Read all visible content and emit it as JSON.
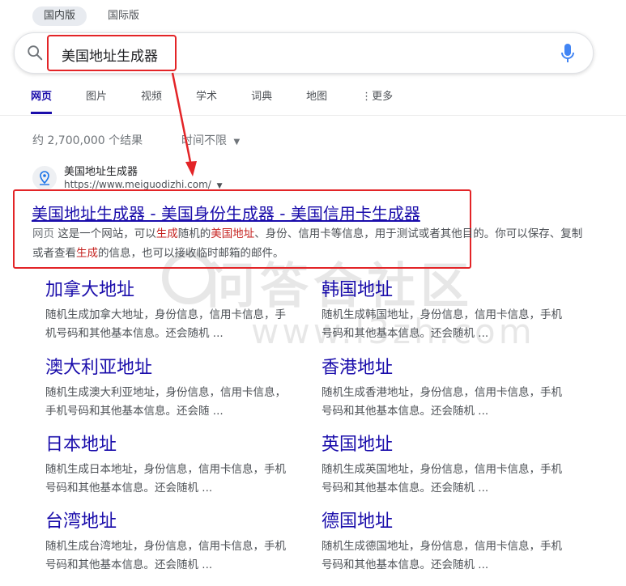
{
  "market_tabs": {
    "domestic": "国内版",
    "international": "国际版"
  },
  "search": {
    "query": "美国地址生成器"
  },
  "nav": {
    "web": "网页",
    "images": "图片",
    "videos": "视频",
    "academic": "学术",
    "dictionary": "词典",
    "maps": "地图",
    "more": "更多"
  },
  "stats": {
    "count": "约 2,700,000 个结果",
    "time_filter": "时间不限"
  },
  "result": {
    "site_name": "美国地址生成器",
    "url": "https://www.meiguodizhi.com/",
    "title": "美国地址生成器 - 美国身份生成器 - 美国信用卡生成器",
    "snippet_tag": "网页",
    "snippet_1": "这是一个网站，可以",
    "snippet_hl_1": "生成",
    "snippet_2": "随机的",
    "snippet_hl_2": "美国地址",
    "snippet_3": "、身份、信用卡等信息，用于测试或者其他目的。你可以保存、复制或者查看",
    "snippet_hl_3": "生成",
    "snippet_4": "的信息，也可以接收临时邮箱的邮件。"
  },
  "watermark": {
    "text": "问答合社区",
    "url": "www.l3zh.com"
  },
  "sitelinks": [
    {
      "title": "加拿大地址",
      "desc": "随机生成加拿大地址，身份信息，信用卡信息，手机号码和其他基本信息。还会随机 ..."
    },
    {
      "title": "韩国地址",
      "desc": "随机生成韩国地址，身份信息，信用卡信息，手机号码和其他基本信息。还会随机 ..."
    },
    {
      "title": "澳大利亚地址",
      "desc": "随机生成澳大利亚地址，身份信息，信用卡信息，手机号码和其他基本信息。还会随 ..."
    },
    {
      "title": "香港地址",
      "desc": "随机生成香港地址，身份信息，信用卡信息，手机号码和其他基本信息。还会随机 ..."
    },
    {
      "title": "日本地址",
      "desc": "随机生成日本地址，身份信息，信用卡信息，手机号码和其他基本信息。还会随机 ..."
    },
    {
      "title": "英国地址",
      "desc": "随机生成英国地址，身份信息，信用卡信息，手机号码和其他基本信息。还会随机 ..."
    },
    {
      "title": "台湾地址",
      "desc": "随机生成台湾地址，身份信息，信用卡信息，手机号码和其他基本信息。还会随机 ..."
    },
    {
      "title": "德国地址",
      "desc": "随机生成德国地址，身份信息，信用卡信息，手机号码和其他基本信息。还会随机 ..."
    }
  ],
  "colors": {
    "link": "#1a0dab",
    "highlight": "#c5221f",
    "annotation": "#e32427"
  }
}
